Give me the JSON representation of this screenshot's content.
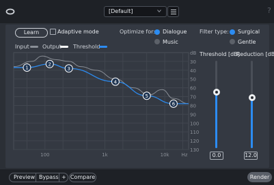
{
  "toolbar": {
    "logo_icon": "infinity-logo-icon",
    "preset_value": "[Default]",
    "menu_icon": "hamburger-menu-icon",
    "help_label": "?"
  },
  "controls": {
    "learn_label": "Learn",
    "adaptive_label": "Adaptive mode",
    "adaptive_checked": false,
    "optimize_label": "Optimize for:",
    "optimize_options": [
      {
        "label": "Dialogue",
        "selected": true
      },
      {
        "label": "Music",
        "selected": false
      }
    ],
    "filter_label": "Filter type:",
    "filter_options": [
      {
        "label": "Surgical",
        "selected": true
      },
      {
        "label": "Gentle",
        "selected": false
      }
    ]
  },
  "legend": {
    "input": "Input",
    "output": "Output",
    "threshold": "Threshold",
    "colors": {
      "input": "#8a8f97",
      "output": "#ffffff",
      "threshold": "#2c8cf2"
    }
  },
  "chart_data": {
    "type": "line",
    "xlabel": "",
    "ylabel": "",
    "x_scale": "log",
    "y_unit": "dB",
    "y_ticks": [
      "dB",
      "30",
      "40",
      "50",
      "60",
      "70",
      "80",
      "90",
      "100",
      "110",
      "120",
      "130"
    ],
    "x_ticks": [
      "100",
      "1k",
      "10k",
      "Hz"
    ],
    "nodes": [
      {
        "label": "1",
        "freq": 50,
        "db": 37
      },
      {
        "label": "2",
        "freq": 120,
        "db": 33
      },
      {
        "label": "3",
        "freq": 250,
        "db": 38
      },
      {
        "label": "4",
        "freq": 1500,
        "db": 53
      },
      {
        "label": "5",
        "freq": 5000,
        "db": 69
      },
      {
        "label": "6",
        "freq": 14000,
        "db": 78
      }
    ]
  },
  "sliders": {
    "threshold": {
      "label": "Threshold [dB]",
      "value": "0.0",
      "fraction": 0.64
    },
    "reduction": {
      "label": "Reduction [dB]",
      "value": "12.0",
      "fraction": 0.58
    }
  },
  "footer": {
    "preview": "Preview",
    "bypass": "Bypass",
    "plus": "+",
    "compare": "Compare",
    "render": "Render"
  }
}
